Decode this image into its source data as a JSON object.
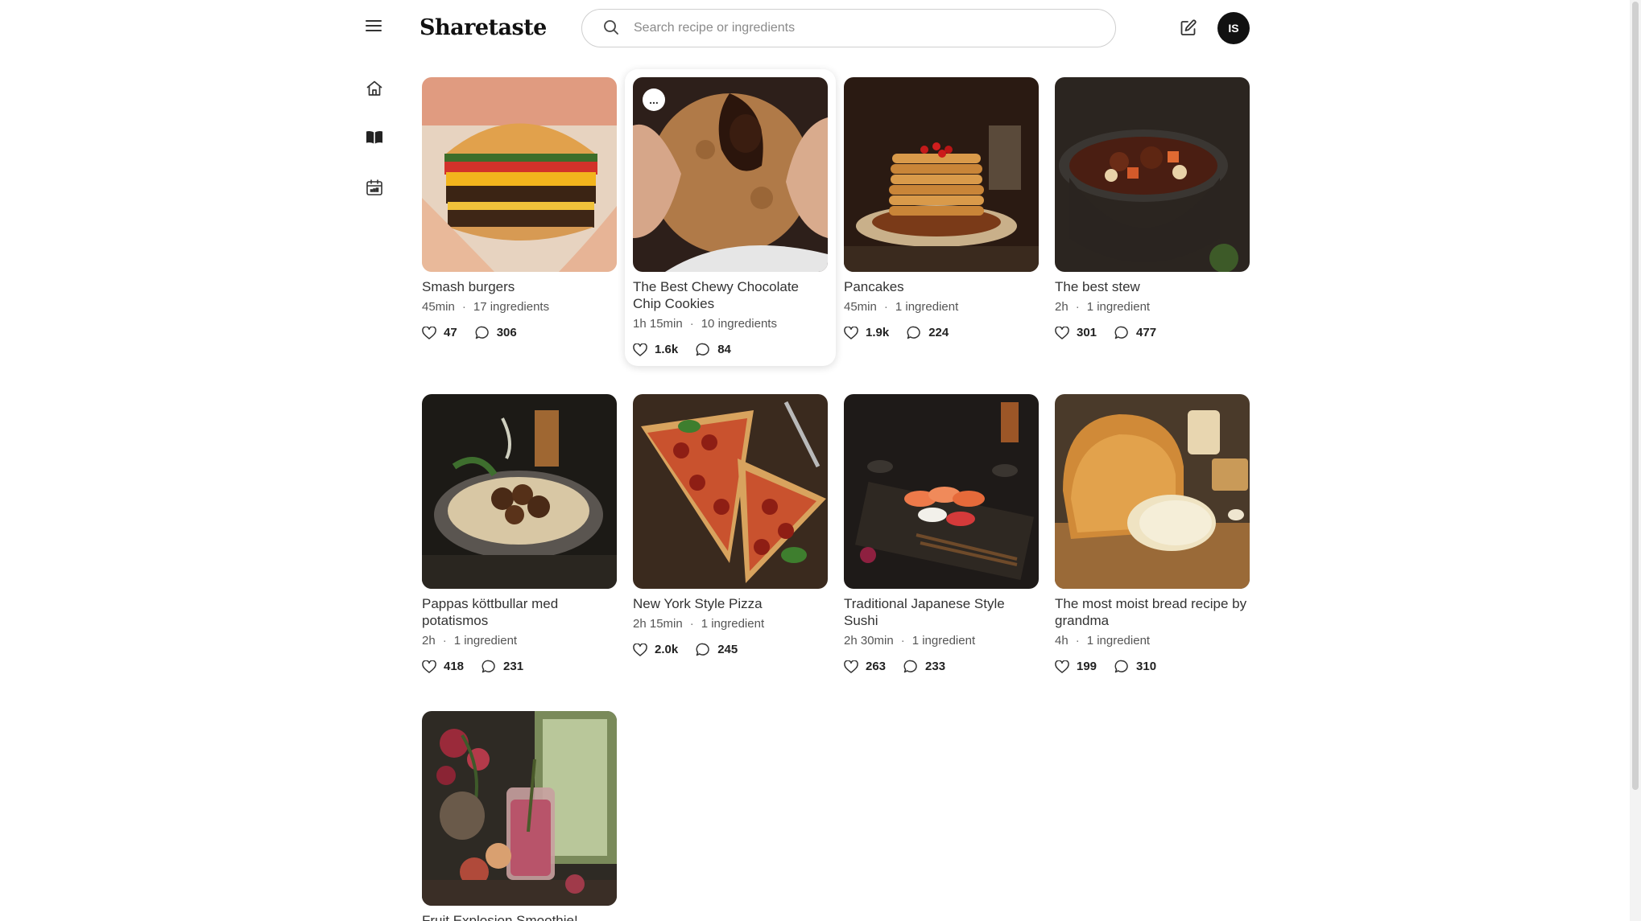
{
  "app": {
    "logo": "Sharetaste",
    "search_placeholder": "Search recipe or ingredients",
    "avatar_initials": "IS"
  },
  "icons": {
    "menu": "menu-icon",
    "home": "home-icon",
    "book": "book-icon",
    "calendar": "calendar-icon",
    "edit": "edit-icon",
    "search": "search-icon",
    "like": "heart-icon",
    "comment": "comment-icon"
  },
  "recipes": [
    {
      "title": "Smash burgers",
      "time": "45min",
      "ingredients": "17 ingredients",
      "likes": "47",
      "comments": "306"
    },
    {
      "title": "The Best Chewy Chocolate Chip Cookies",
      "time": "1h 15min",
      "ingredients": "10 ingredients",
      "likes": "1.6k",
      "comments": "84",
      "more": "..."
    },
    {
      "title": "Pancakes",
      "time": "45min",
      "ingredients": "1 ingredient",
      "likes": "1.9k",
      "comments": "224"
    },
    {
      "title": "The best stew",
      "time": "2h",
      "ingredients": "1 ingredient",
      "likes": "301",
      "comments": "477"
    },
    {
      "title": "Pappas köttbullar med potatismos",
      "time": "2h",
      "ingredients": "1 ingredient",
      "likes": "418",
      "comments": "231"
    },
    {
      "title": "New York Style Pizza",
      "time": "2h 15min",
      "ingredients": "1 ingredient",
      "likes": "2.0k",
      "comments": "245"
    },
    {
      "title": "Traditional Japanese Style Sushi",
      "time": "2h 30min",
      "ingredients": "1 ingredient",
      "likes": "263",
      "comments": "233"
    },
    {
      "title": "The most moist bread recipe by grandma",
      "time": "4h",
      "ingredients": "1 ingredient",
      "likes": "199",
      "comments": "310"
    },
    {
      "title": "Fruit Explosion Smoothie!",
      "time": "",
      "ingredients": "",
      "likes": "",
      "comments": ""
    }
  ]
}
